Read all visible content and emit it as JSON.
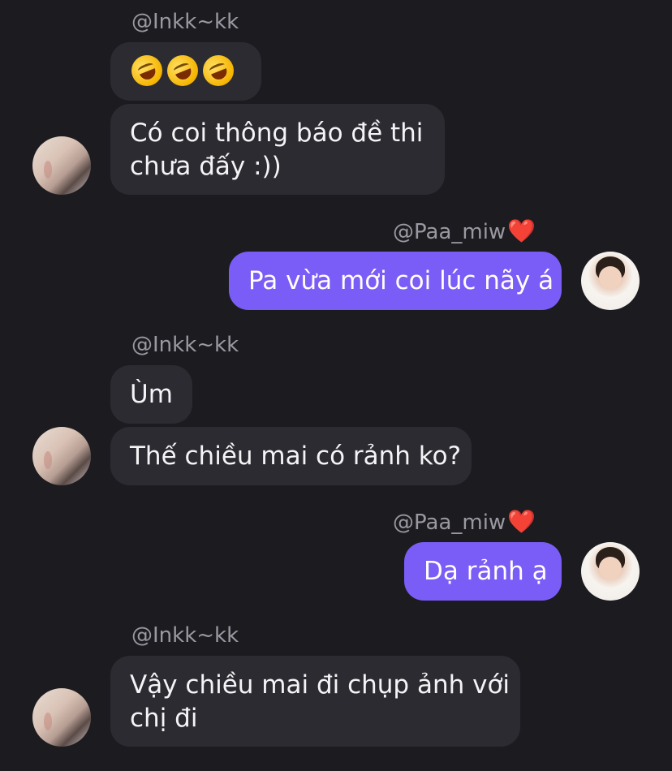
{
  "messages": [
    {
      "sender": "@Inkk~kk"
    },
    {
      "text": "Có coi thông báo đề thi"
    },
    {
      "text2": "chưa đấy :))"
    },
    {
      "sender": "@Paa_miw",
      "heart": "❤️"
    },
    {
      "text": "Pa vừa mới coi lúc nãy á"
    },
    {
      "sender": "@Inkk~kk"
    },
    {
      "text": "Ùm"
    },
    {
      "text": "Thế chiều mai có rảnh ko?"
    },
    {
      "sender": "@Paa_miw",
      "heart": "❤️"
    },
    {
      "text": "Dạ rảnh ạ"
    },
    {
      "sender": "@Inkk~kk"
    },
    {
      "text": "Vậy chiều mai đi chụp ảnh với"
    },
    {
      "text2": "chị đi"
    }
  ],
  "emoji_message": {
    "icons": [
      "rolling-on-floor-laughing-icon",
      "rolling-on-floor-laughing-icon",
      "rolling-on-floor-laughing-icon"
    ]
  },
  "colors": {
    "background": "#1c1b20",
    "incoming_bubble": "#2c2b31",
    "outgoing_bubble": "#7a5cf6",
    "sender_text": "#9a99a1",
    "heart": "#e8323c"
  }
}
